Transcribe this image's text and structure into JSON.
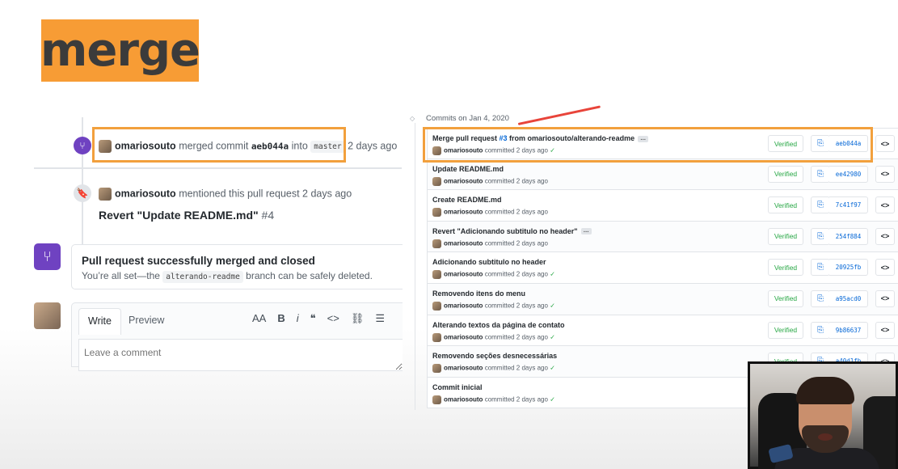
{
  "slide": {
    "title": "merge",
    "accent_color": "#f79c35"
  },
  "timeline": {
    "merge_event": {
      "user": "omariosouto",
      "action": "merged commit",
      "commit": "aeb044a",
      "into": "into",
      "branch": "master",
      "time": "2 days ago"
    },
    "reference_event": {
      "user": "omariosouto",
      "action": "mentioned this pull request 2 days ago",
      "title": "Revert \"Update README.md\"",
      "number": "#4"
    },
    "merged_notice": {
      "title": "Pull request successfully merged and closed",
      "sub_before": "You’re all set—the",
      "branch": "alterando-readme",
      "sub_after": "branch can be safely deleted."
    },
    "comment": {
      "tab_write": "Write",
      "tab_preview": "Preview",
      "placeholder": "Leave a comment",
      "toolbar": {
        "heading": "AA",
        "bold": "B",
        "italic": "i",
        "quote": "❝",
        "code": "<>",
        "link": "⛓",
        "list": "☰"
      }
    }
  },
  "commits": {
    "header": "Commits on Jan 4, 2020",
    "verified_label": "Verified",
    "browse_label": "<>",
    "copy_icon": "clipboard-icon",
    "items": [
      {
        "message_before": "Merge pull request ",
        "pr": "#3",
        "message_after": " from omariosouto/alterando-readme",
        "ellipsis": true,
        "user": "omariosouto",
        "meta": "committed 2 days ago",
        "check": true,
        "sha": "aeb044a"
      },
      {
        "message_before": "Update README.md",
        "pr": "",
        "message_after": "",
        "ellipsis": false,
        "user": "omariosouto",
        "meta": "committed 2 days ago",
        "check": false,
        "sha": "ee42980"
      },
      {
        "message_before": "Create README.md",
        "pr": "",
        "message_after": "",
        "ellipsis": false,
        "user": "omariosouto",
        "meta": "committed 2 days ago",
        "check": false,
        "sha": "7c41f97"
      },
      {
        "message_before": "Revert \"Adicionando subtitulo no header\"",
        "pr": "",
        "message_after": "",
        "ellipsis": true,
        "user": "omariosouto",
        "meta": "committed 2 days ago",
        "check": false,
        "sha": "254f884"
      },
      {
        "message_before": "Adicionando subtitulo no header",
        "pr": "",
        "message_after": "",
        "ellipsis": false,
        "user": "omariosouto",
        "meta": "committed 2 days ago",
        "check": true,
        "sha": "20925fb"
      },
      {
        "message_before": "Removendo itens do menu",
        "pr": "",
        "message_after": "",
        "ellipsis": false,
        "user": "omariosouto",
        "meta": "committed 2 days ago",
        "check": true,
        "sha": "a95acd0"
      },
      {
        "message_before": "Alterando textos da página de contato",
        "pr": "",
        "message_after": "",
        "ellipsis": false,
        "user": "omariosouto",
        "meta": "committed 2 days ago",
        "check": true,
        "sha": "9b86637"
      },
      {
        "message_before": "Removendo seções desnecessárias",
        "pr": "",
        "message_after": "",
        "ellipsis": false,
        "user": "omariosouto",
        "meta": "committed 2 days ago",
        "check": true,
        "sha": "a40d1fb"
      },
      {
        "message_before": "Commit inicial",
        "pr": "",
        "message_after": "",
        "ellipsis": false,
        "user": "omariosouto",
        "meta": "committed 2 days ago",
        "check": true,
        "sha": ""
      }
    ]
  },
  "colors": {
    "highlight": "#f2a03d",
    "annotation": "#e8443a",
    "merged_purple": "#6f42c1",
    "link_blue": "#0366d6",
    "verified_green": "#28a745"
  }
}
